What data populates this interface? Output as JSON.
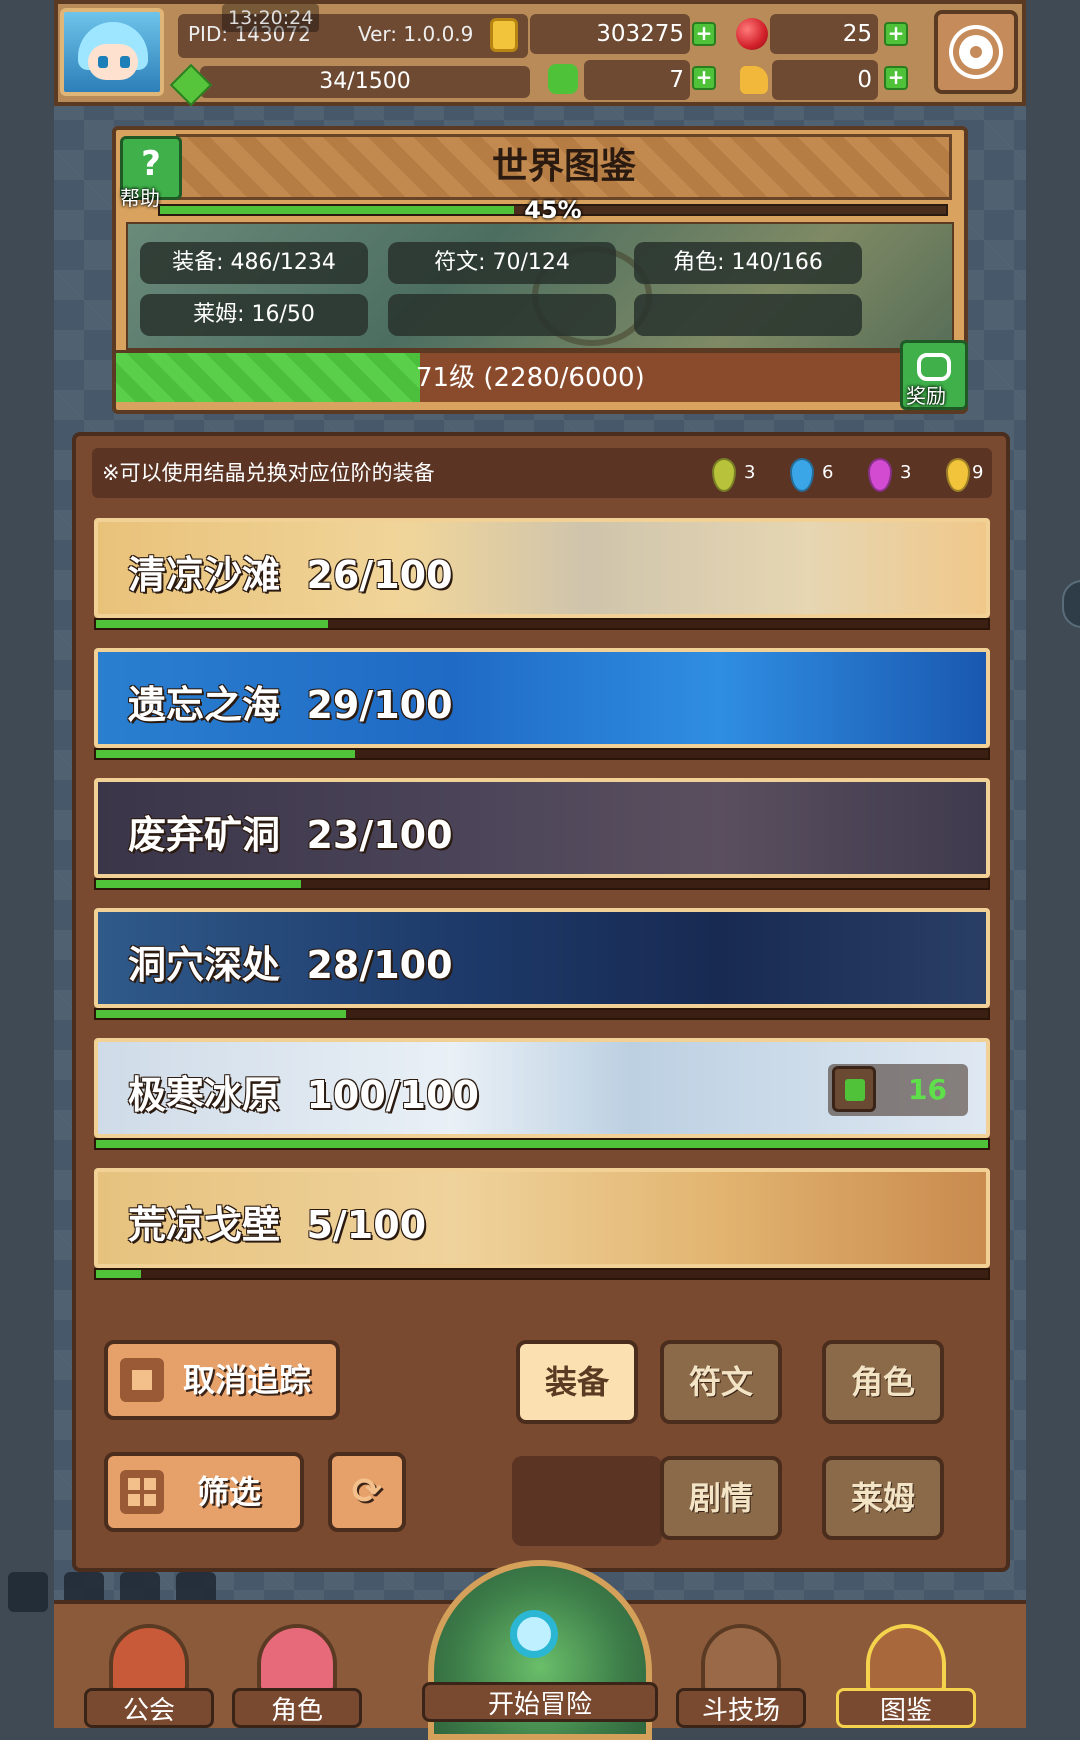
{
  "status": {
    "time": "13:20:24"
  },
  "player": {
    "pid": "PID: 143072",
    "version": "Ver: 1.0.0.9",
    "gold": "303275",
    "red_gems": "25",
    "energy": "34/1500",
    "clovers": "7",
    "keys": "0"
  },
  "atlas": {
    "title": "世界图鉴",
    "help_label": "帮助",
    "overall_progress": "45%",
    "stats": {
      "equipment": "装备: 486/1234",
      "runes": "符文: 70/124",
      "characters": "角色: 140/166",
      "slimes": "莱姆: 16/50"
    },
    "level_text": "71级 (2280/6000)",
    "reward_label": "奖励"
  },
  "notice": {
    "text": "※可以使用结晶兑换对应位阶的装备",
    "crystals": [
      {
        "color": "#b8c23a",
        "count": "3"
      },
      {
        "color": "#3aa6e8",
        "count": "6"
      },
      {
        "color": "#d24bd0",
        "count": "3"
      },
      {
        "color": "#f2c43b",
        "count": "9"
      }
    ]
  },
  "areas": [
    {
      "label": "清凉沙滩  26/100",
      "progress": 0.26
    },
    {
      "label": "遗忘之海  29/100",
      "progress": 0.29
    },
    {
      "label": "废弃矿洞  23/100",
      "progress": 0.23
    },
    {
      "label": "洞穴深处  28/100",
      "progress": 0.28
    },
    {
      "label": "极寒冰原  100/100",
      "progress": 1.0,
      "likes": "16"
    },
    {
      "label": "荒凉戈壁  5/100",
      "progress": 0.05
    }
  ],
  "controls": {
    "untrack": "取消追踪",
    "filter": "筛选",
    "tabs": {
      "equipment": "装备",
      "runes": "符文",
      "characters": "角色",
      "story": "剧情",
      "slimes": "莱姆"
    }
  },
  "nav": {
    "guild": "公会",
    "character": "角色",
    "adventure": "开始冒险",
    "arena": "斗技场",
    "atlas": "图鉴"
  },
  "colors": {
    "accent_green": "#4fc23a",
    "panel_brown": "#7a4a30",
    "selected_tab": "#fbe1b2"
  }
}
